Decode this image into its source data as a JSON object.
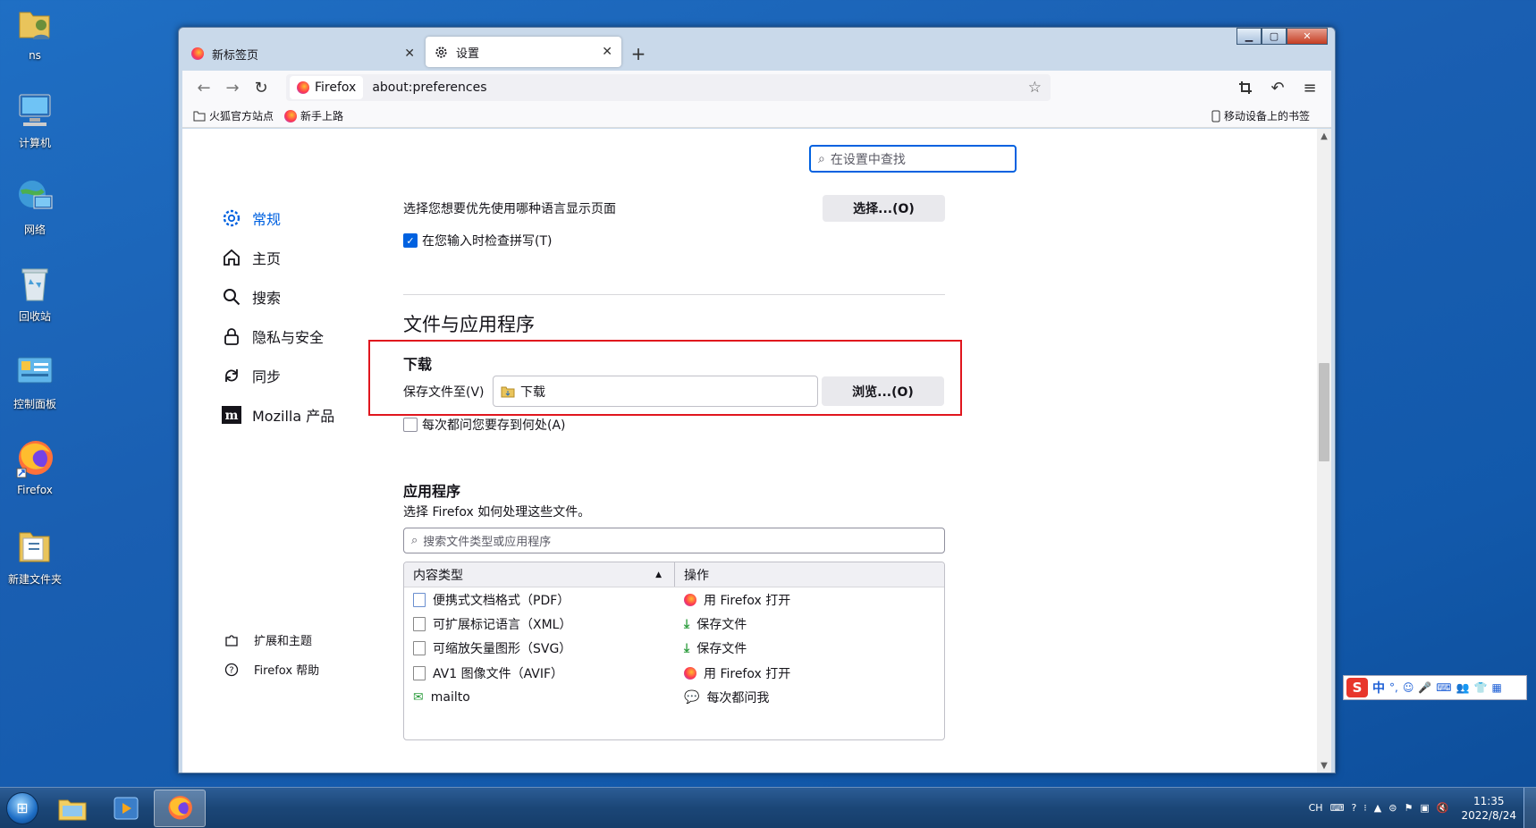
{
  "desktop": {
    "icons": [
      {
        "label": "ns",
        "icon": "user-folder-icon"
      },
      {
        "label": "计算机",
        "icon": "computer-icon"
      },
      {
        "label": "网络",
        "icon": "network-icon"
      },
      {
        "label": "回收站",
        "icon": "recycle-bin-icon"
      },
      {
        "label": "控制面板",
        "icon": "control-panel-icon"
      },
      {
        "label": "Firefox",
        "icon": "firefox-icon"
      },
      {
        "label": "新建文件夹",
        "icon": "folder-icon"
      }
    ]
  },
  "browser": {
    "tabs": [
      {
        "title": "新标签页",
        "active": false
      },
      {
        "title": "设置",
        "active": true
      }
    ],
    "new_tab": "+",
    "url_identity": "Firefox",
    "url": "about:preferences",
    "bookmarks": [
      "火狐官方站点",
      "新手上路"
    ],
    "bookmarks_right": "移动设备上的书签"
  },
  "settings": {
    "search_placeholder": "在设置中查找",
    "nav": [
      {
        "label": "常规",
        "icon": "gear-icon",
        "selected": true
      },
      {
        "label": "主页",
        "icon": "home-icon",
        "selected": false
      },
      {
        "label": "搜索",
        "icon": "search-icon",
        "selected": false
      },
      {
        "label": "隐私与安全",
        "icon": "lock-icon",
        "selected": false
      },
      {
        "label": "同步",
        "icon": "sync-icon",
        "selected": false
      },
      {
        "label": "Mozilla 产品",
        "icon": "mozilla-icon",
        "selected": false
      }
    ],
    "nav_bottom": [
      {
        "label": "扩展和主题",
        "icon": "puzzle-icon"
      },
      {
        "label": "Firefox 帮助",
        "icon": "help-icon"
      }
    ],
    "language_text": "选择您想要优先使用哪种语言显示页面",
    "language_button": "选择...(O)",
    "spellcheck_label": "在您输入时检查拼写(T)",
    "spellcheck_checked": true,
    "files_heading": "文件与应用程序",
    "download_heading": "下载",
    "save_to_label": "保存文件至(V)",
    "download_folder": "下载",
    "browse_button": "浏览...(O)",
    "ask_label": "每次都问您要存到何处(A)",
    "ask_checked": false,
    "apps_heading": "应用程序",
    "apps_desc": "选择 Firefox 如何处理这些文件。",
    "apps_search_placeholder": "搜索文件类型或应用程序",
    "table": {
      "col_type": "内容类型",
      "col_action": "操作",
      "rows": [
        {
          "type": "便携式文档格式（PDF）",
          "action": "用 Firefox 打开"
        },
        {
          "type": "可扩展标记语言（XML）",
          "action": "保存文件"
        },
        {
          "type": "可缩放矢量图形（SVG）",
          "action": "保存文件"
        },
        {
          "type": "AV1 图像文件（AVIF）",
          "action": "用 Firefox 打开"
        },
        {
          "type": "mailto",
          "action": "每次都问我"
        }
      ]
    }
  },
  "taskbar": {
    "tray_lang": "CH",
    "time": "11:35",
    "date": "2022/8/24"
  },
  "ime": {
    "mode": "中"
  }
}
